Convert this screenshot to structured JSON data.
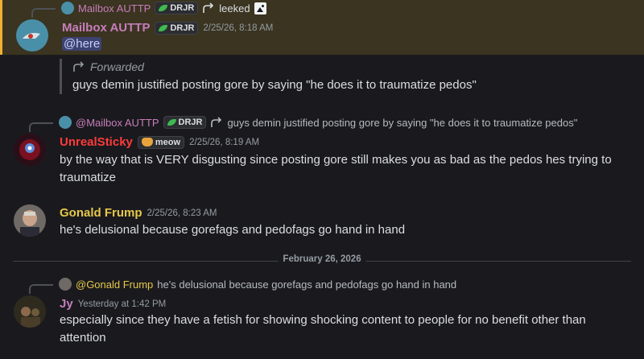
{
  "colors": {
    "mailbox_name": "#c77dba",
    "unreal_name": "#ff3b3b",
    "gonald_name": "#e6c84a",
    "jy_name": "#c77dba"
  },
  "messages": [
    {
      "reply": {
        "author": "Mailbox AUTTP",
        "tag": "DRJR",
        "text": "leeked",
        "has_image_icon": true
      },
      "author": "Mailbox AUTTP",
      "tag": "DRJR",
      "timestamp": "2/25/26, 8:18 AM",
      "mention": "@here",
      "forward_label": "Forwarded",
      "forward_text": "guys demin justified posting gore by saying \"he does it to traumatize pedos\""
    },
    {
      "reply": {
        "author": "@Mailbox AUTTP",
        "tag": "DRJR",
        "text": "guys demin justified posting gore by saying \"he does it to traumatize pedos\""
      },
      "author": "UnrealSticky",
      "tag": "meow",
      "timestamp": "2/25/26, 8:19 AM",
      "text": "by the way that is VERY disgusting since posting gore still makes you as bad as the pedos hes trying to traumatize"
    },
    {
      "author": "Gonald Frump",
      "timestamp": "2/25/26, 8:23 AM",
      "text": "he's delusional because gorefags and pedofags go hand in hand"
    },
    {
      "reply": {
        "author": "@Gonald Frump",
        "text": "he's delusional because gorefags and pedofags go hand in hand"
      },
      "author": "Jy",
      "timestamp": "Yesterday at 1:42 PM",
      "text": "especially since they have a fetish for showing shocking content to people for no benefit other than attention"
    }
  ],
  "date_divider": "February 26, 2026"
}
